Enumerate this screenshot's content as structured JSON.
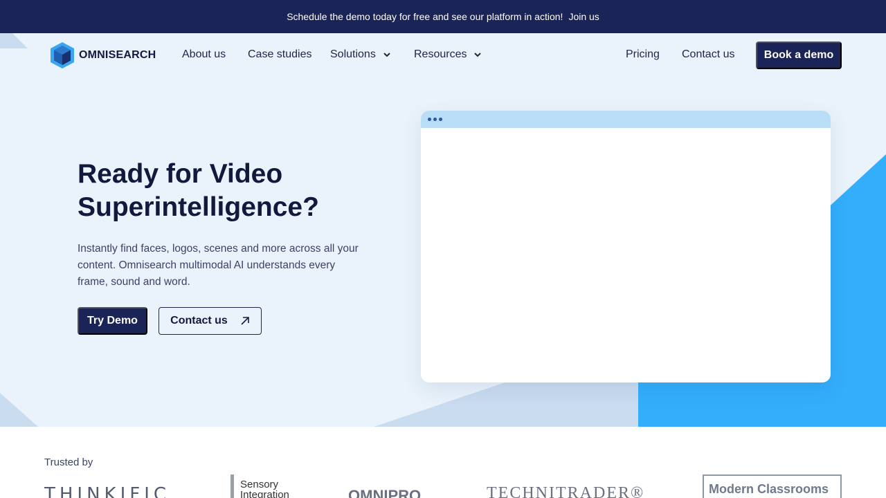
{
  "announcement": {
    "message": "Schedule the demo today for free and see our platform in action!",
    "link": "Join us"
  },
  "brand": {
    "name": "OMNISEARCH"
  },
  "nav": {
    "about": "About us",
    "case_studies": "Case studies",
    "solutions": "Solutions",
    "resources": "Resources",
    "pricing": "Pricing",
    "contact": "Contact us",
    "book_demo": "Book a demo"
  },
  "hero": {
    "headline_line1": "Ready for Video",
    "headline_line2": "Superintelligence?",
    "subtitle": "Instantly find faces, logos, scenes and more across all your content. Omnisearch multimodal AI understands every frame, sound and word.",
    "try_demo": "Try Demo",
    "contact": "Contact us"
  },
  "trusted": {
    "label": "Trusted by",
    "logos": [
      "THINKIFIC",
      "Sensory Integration",
      "OMNIPRO",
      "TECHNITRADER®",
      "Modern Classrooms"
    ]
  },
  "colors": {
    "navy": "#1a2456",
    "hero_bg": "#eaf3fb",
    "accent_blue": "#33aefb",
    "window_bar": "#b9dcf7"
  }
}
